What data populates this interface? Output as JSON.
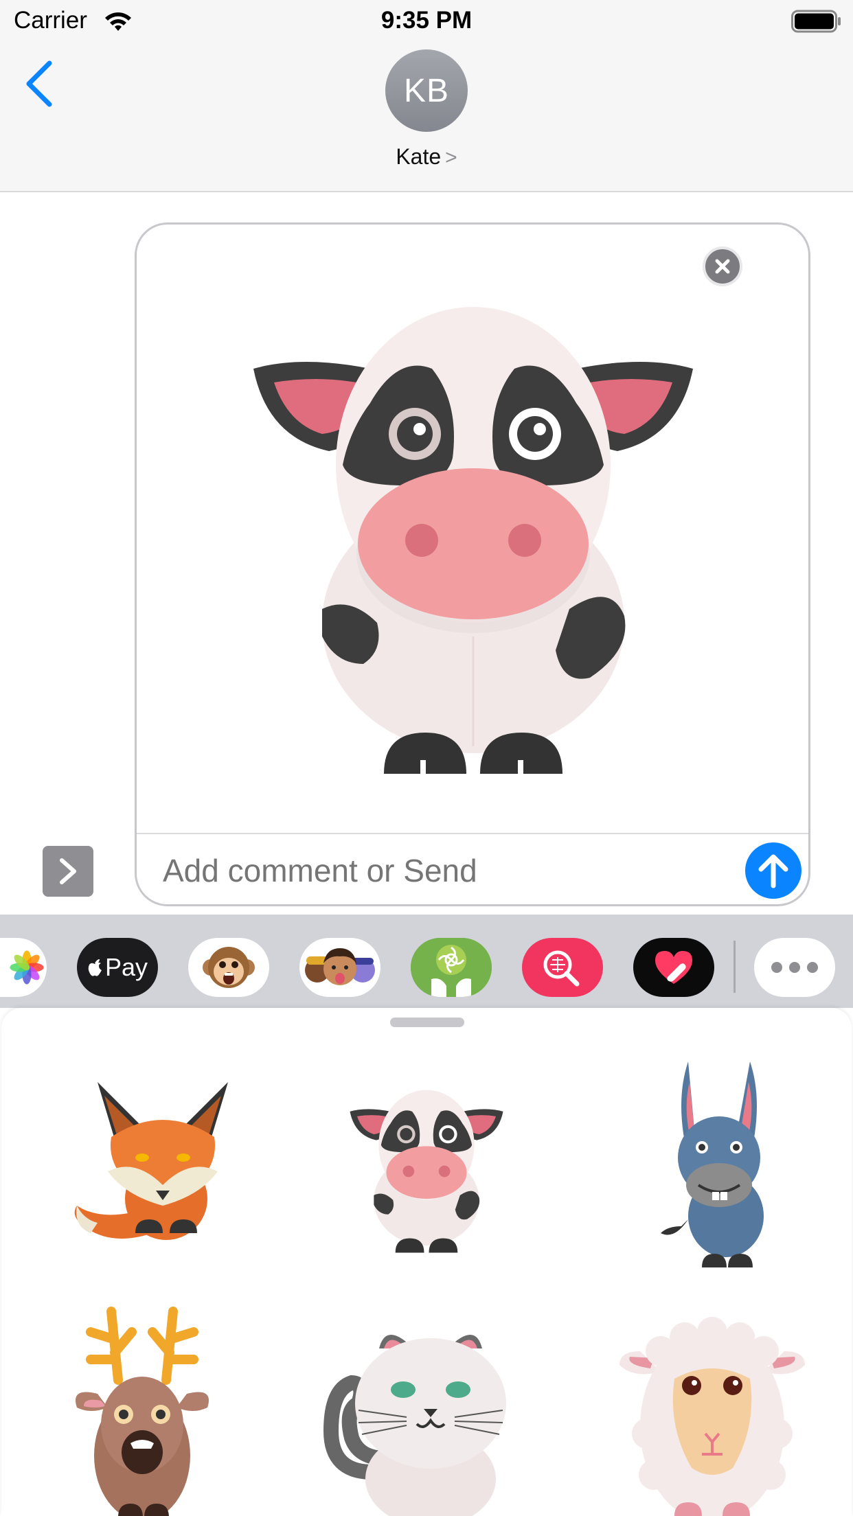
{
  "status_bar": {
    "carrier": "Carrier",
    "time": "9:35 PM"
  },
  "nav": {
    "avatar_initials": "KB",
    "contact_name": "Kate",
    "chevron": ">"
  },
  "compose": {
    "comment_placeholder": "Add comment or Send",
    "selected_sticker": "cow"
  },
  "app_strip": {
    "apps": [
      {
        "name": "photos-app-icon"
      },
      {
        "name": "apple-pay-app-icon",
        "label": "Pay"
      },
      {
        "name": "animoji-app-icon"
      },
      {
        "name": "memoji-app-icon"
      },
      {
        "name": "sticker-app-icon"
      },
      {
        "name": "search-images-app-icon"
      },
      {
        "name": "digital-touch-app-icon"
      },
      {
        "name": "more-apps-icon"
      }
    ]
  },
  "stickers": [
    {
      "name": "fox"
    },
    {
      "name": "cow"
    },
    {
      "name": "donkey"
    },
    {
      "name": "deer"
    },
    {
      "name": "cat"
    },
    {
      "name": "sheep"
    }
  ],
  "colors": {
    "accent_blue": "#0a84ff",
    "applepay_red": "#ff2d55"
  }
}
